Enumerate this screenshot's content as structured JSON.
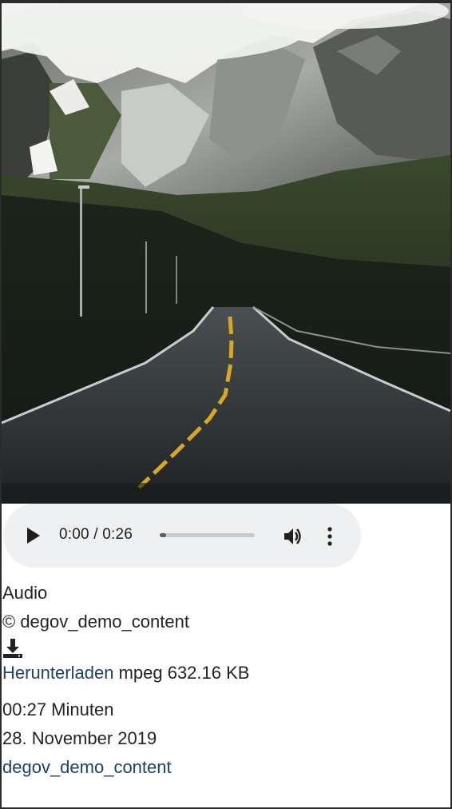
{
  "image": {
    "alt_semantic": "mountain-road-photo"
  },
  "player": {
    "current_time": "0:00",
    "duration": "0:26",
    "time_display": "0:00 / 0:26",
    "progress_fraction": 0.07
  },
  "media_info": {
    "type_label": "Audio",
    "copyright": "© degov_demo_content",
    "download_icon": "download-icon",
    "download_link": "Herunterladen",
    "file_info": "mpeg 632.16 KB",
    "duration_text": "00:27 Minuten",
    "date": "28. November 2019",
    "author_link": "degov_demo_content"
  },
  "colors": {
    "link": "#1c4266",
    "player_bg": "#eff0f1",
    "road_line": "#d9a720"
  }
}
